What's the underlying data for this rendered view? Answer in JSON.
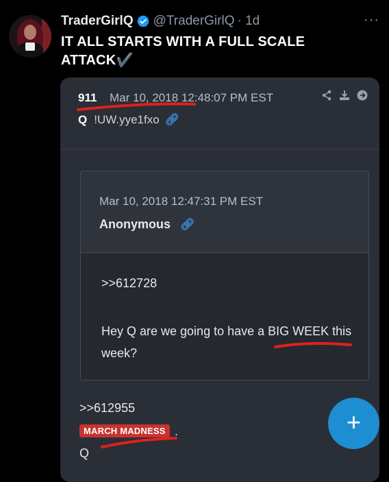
{
  "tweet": {
    "author_name": "TraderGirlQ",
    "handle": "@TraderGirlQ",
    "time": "· 1d",
    "more": "···",
    "text": "IT ALL STARTS WITH A FULL SCALE ATTACK✔️"
  },
  "post": {
    "number": "911",
    "date": "Mar 10, 2018 12:48:07 PM EST",
    "tripcode": "!UW.yye1fxo",
    "q_label": "Q",
    "tools": [
      "share-icon",
      "download-icon",
      "arrow-right-icon"
    ],
    "quoted": {
      "date": "Mar 10, 2018 12:47:31 PM EST",
      "author": "Anonymous",
      "ref": ">>612728",
      "message": "Hey Q are we going to have a BIG WEEK this week?"
    },
    "reply_ref": ">>612955",
    "highlight": "MARCH MADNESS",
    "period": ".",
    "signature": "Q"
  },
  "colors": {
    "accent": "#1d9bf0",
    "underline_red": "#e0201c",
    "highlight_red": "#c6332f",
    "card_bg": "#2a2e36"
  }
}
